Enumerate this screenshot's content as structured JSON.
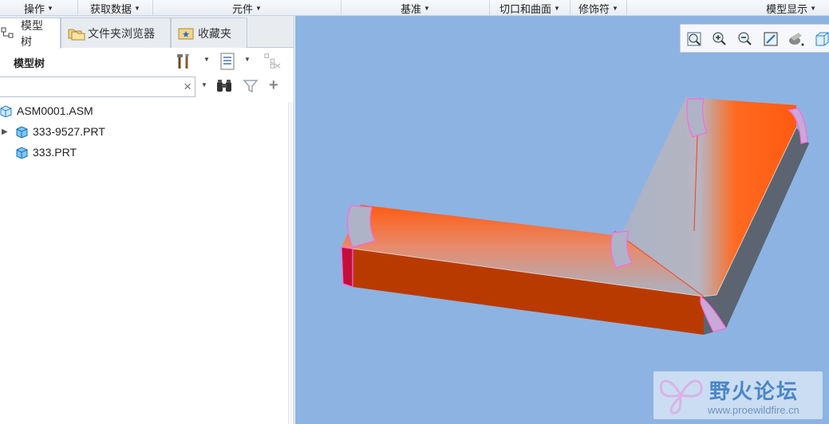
{
  "ribbon": {
    "groups": [
      "操作",
      "获取数据",
      "元件",
      "基准",
      "切口和曲面",
      "修饰符",
      "模型显示"
    ]
  },
  "left_panel": {
    "tabs": [
      {
        "label": "模型树",
        "icon": "model-tree-icon",
        "active": true
      },
      {
        "label": "文件夹浏览器",
        "icon": "folder-browser-icon",
        "active": false
      },
      {
        "label": "收藏夹",
        "icon": "favorites-icon",
        "active": false
      }
    ],
    "header": {
      "title": "模型树"
    },
    "search": {
      "value": "",
      "placeholder": ""
    },
    "tree": [
      {
        "label": "ASM0001.ASM",
        "type": "assembly",
        "expandable": false
      },
      {
        "label": "333-9527.PRT",
        "type": "part",
        "expandable": true
      },
      {
        "label": "333.PRT",
        "type": "part",
        "expandable": false
      }
    ]
  },
  "viewport": {
    "background": "#8db3e2",
    "toolbar": [
      "refit-icon",
      "zoom-in-icon",
      "zoom-out-icon",
      "repaint-icon",
      "spin-center-icon",
      "display-style-icon"
    ],
    "model_colors": {
      "top": "#a9b3c6",
      "front": "#b93a00",
      "side": "#5b6470",
      "highlight": "#ff5a10",
      "edge": "#ff66dd"
    }
  },
  "watermark": {
    "title": "野火论坛",
    "url": "www.proewildfire.cn"
  }
}
